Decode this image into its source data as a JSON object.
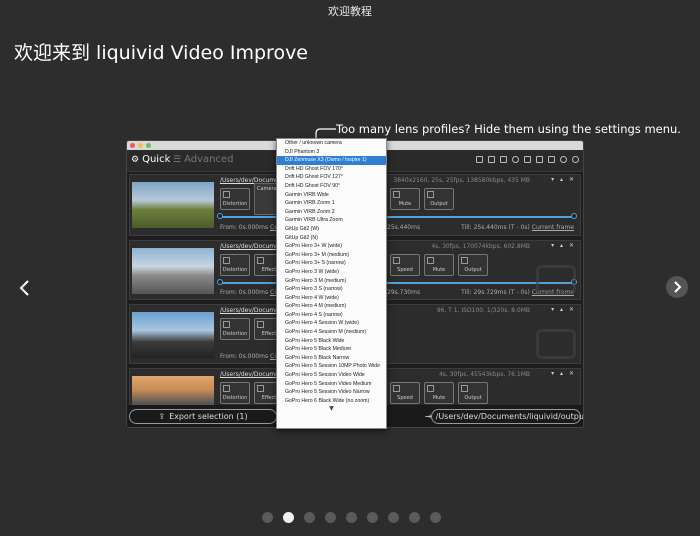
{
  "window": {
    "title": "欢迎教程"
  },
  "headline": "欢迎来到 liquivid Video Improve",
  "callout": "Too many lens profiles? Hide them using the settings menu.",
  "app": {
    "tabs": {
      "quick": "Quick",
      "advanced": "Advanced"
    },
    "clips": [
      {
        "path": "/Users/dev/Documents/li",
        "meta": "3840x2160, 25s, 25fps, 138580kbps, 435 MB",
        "from": "From:  0s.000ms",
        "from_link": "Current",
        "mid": "25s.440ms",
        "till": "Till:  25s.440ms (T - 0s)",
        "till_link": "Current frame",
        "pills": [
          "Distortion",
          "Effect",
          "Stabilize",
          "Deflicker",
          "Speed",
          "Mute",
          "Output"
        ]
      },
      {
        "path": "/Users/dev/Documents/li",
        "meta": "4s, 30fps, 170074kbps, 602.8MB",
        "from": "From:  0s.000ms",
        "from_link": "Current",
        "mid": "29s.730ms",
        "till": "Till:  29s.729ms (T - 0s)",
        "till_link": "Current frame",
        "pills": [
          "Distortion",
          "Effect",
          "Rotate",
          "Stabilize",
          "Deflicker",
          "Speed",
          "Mute",
          "Output"
        ]
      },
      {
        "path": "/Users/dev/Documents/li",
        "meta": "96, T 1, ISO100, 1/320s, 8.0MB",
        "from": "From:  0s.000ms",
        "from_link": "Current",
        "mid": "",
        "till": "",
        "till_link": "",
        "pills": [
          "Distortion",
          "Effect",
          "Rotate",
          "Output"
        ]
      },
      {
        "path": "/Users/dev/Documents/li",
        "meta": "4s, 30fps, 45543kbps, 76.1MB",
        "from": "",
        "from_link": "",
        "mid": "",
        "till": "",
        "till_link": "",
        "pills": [
          "Distortion",
          "Effect",
          "Rotate",
          "Stabilize",
          "Deflicker",
          "Speed",
          "Mute",
          "Output"
        ]
      }
    ],
    "camera_popup": "Camera",
    "export_button": "Export selection (1)",
    "output_button": "/Users/dev/Documents/liquivid/output"
  },
  "dropdown": {
    "items": [
      "Other / unknown camera",
      "DJI Phantom 3",
      "DJI Zenmuse X3 (Osmo / Inspire 1)",
      "Drift HD Ghost FOV 170°",
      "Drift HD Ghost FOV 127°",
      "Drift HD Ghost FOV 90°",
      "Garmin VIRB Wide",
      "Garmin VIRB Zoom 1",
      "Garmin VIRB Zoom 2",
      "Garmin VIRB Ultra Zoom",
      "GitUp Git2 (W)",
      "GitUp Git2 (N)",
      "GoPro Hero 3+ W (wide)",
      "GoPro Hero 3+ M (medium)",
      "GoPro Hero 3+ S (narrow)",
      "GoPro Hero 3 W (wide)",
      "GoPro Hero 3 M (medium)",
      "GoPro Hero 3 S (narrow)",
      "GoPro Hero 4 W (wide)",
      "GoPro Hero 4 M (medium)",
      "GoPro Hero 4 S (narrow)",
      "GoPro Hero 4 Session W (wide)",
      "GoPro Hero 4 Session M (medium)",
      "GoPro Hero 5 Black Wide",
      "GoPro Hero 5 Black Medium",
      "GoPro Hero 5 Black Narrow",
      "GoPro Hero 5 Session 10MP Photo Wide",
      "GoPro Hero 5 Session Video Wide",
      "GoPro Hero 5 Session Video Medium",
      "GoPro Hero 5 Session Video Narrow",
      "GoPro Hero 6 Black Wide (no zoom)"
    ],
    "selected_index": 2,
    "more_indicator": "▼"
  },
  "pagination": {
    "count": 9,
    "active": 1
  },
  "colors": {
    "accent": "#4da3d9",
    "selected": "#2f7fd0"
  }
}
